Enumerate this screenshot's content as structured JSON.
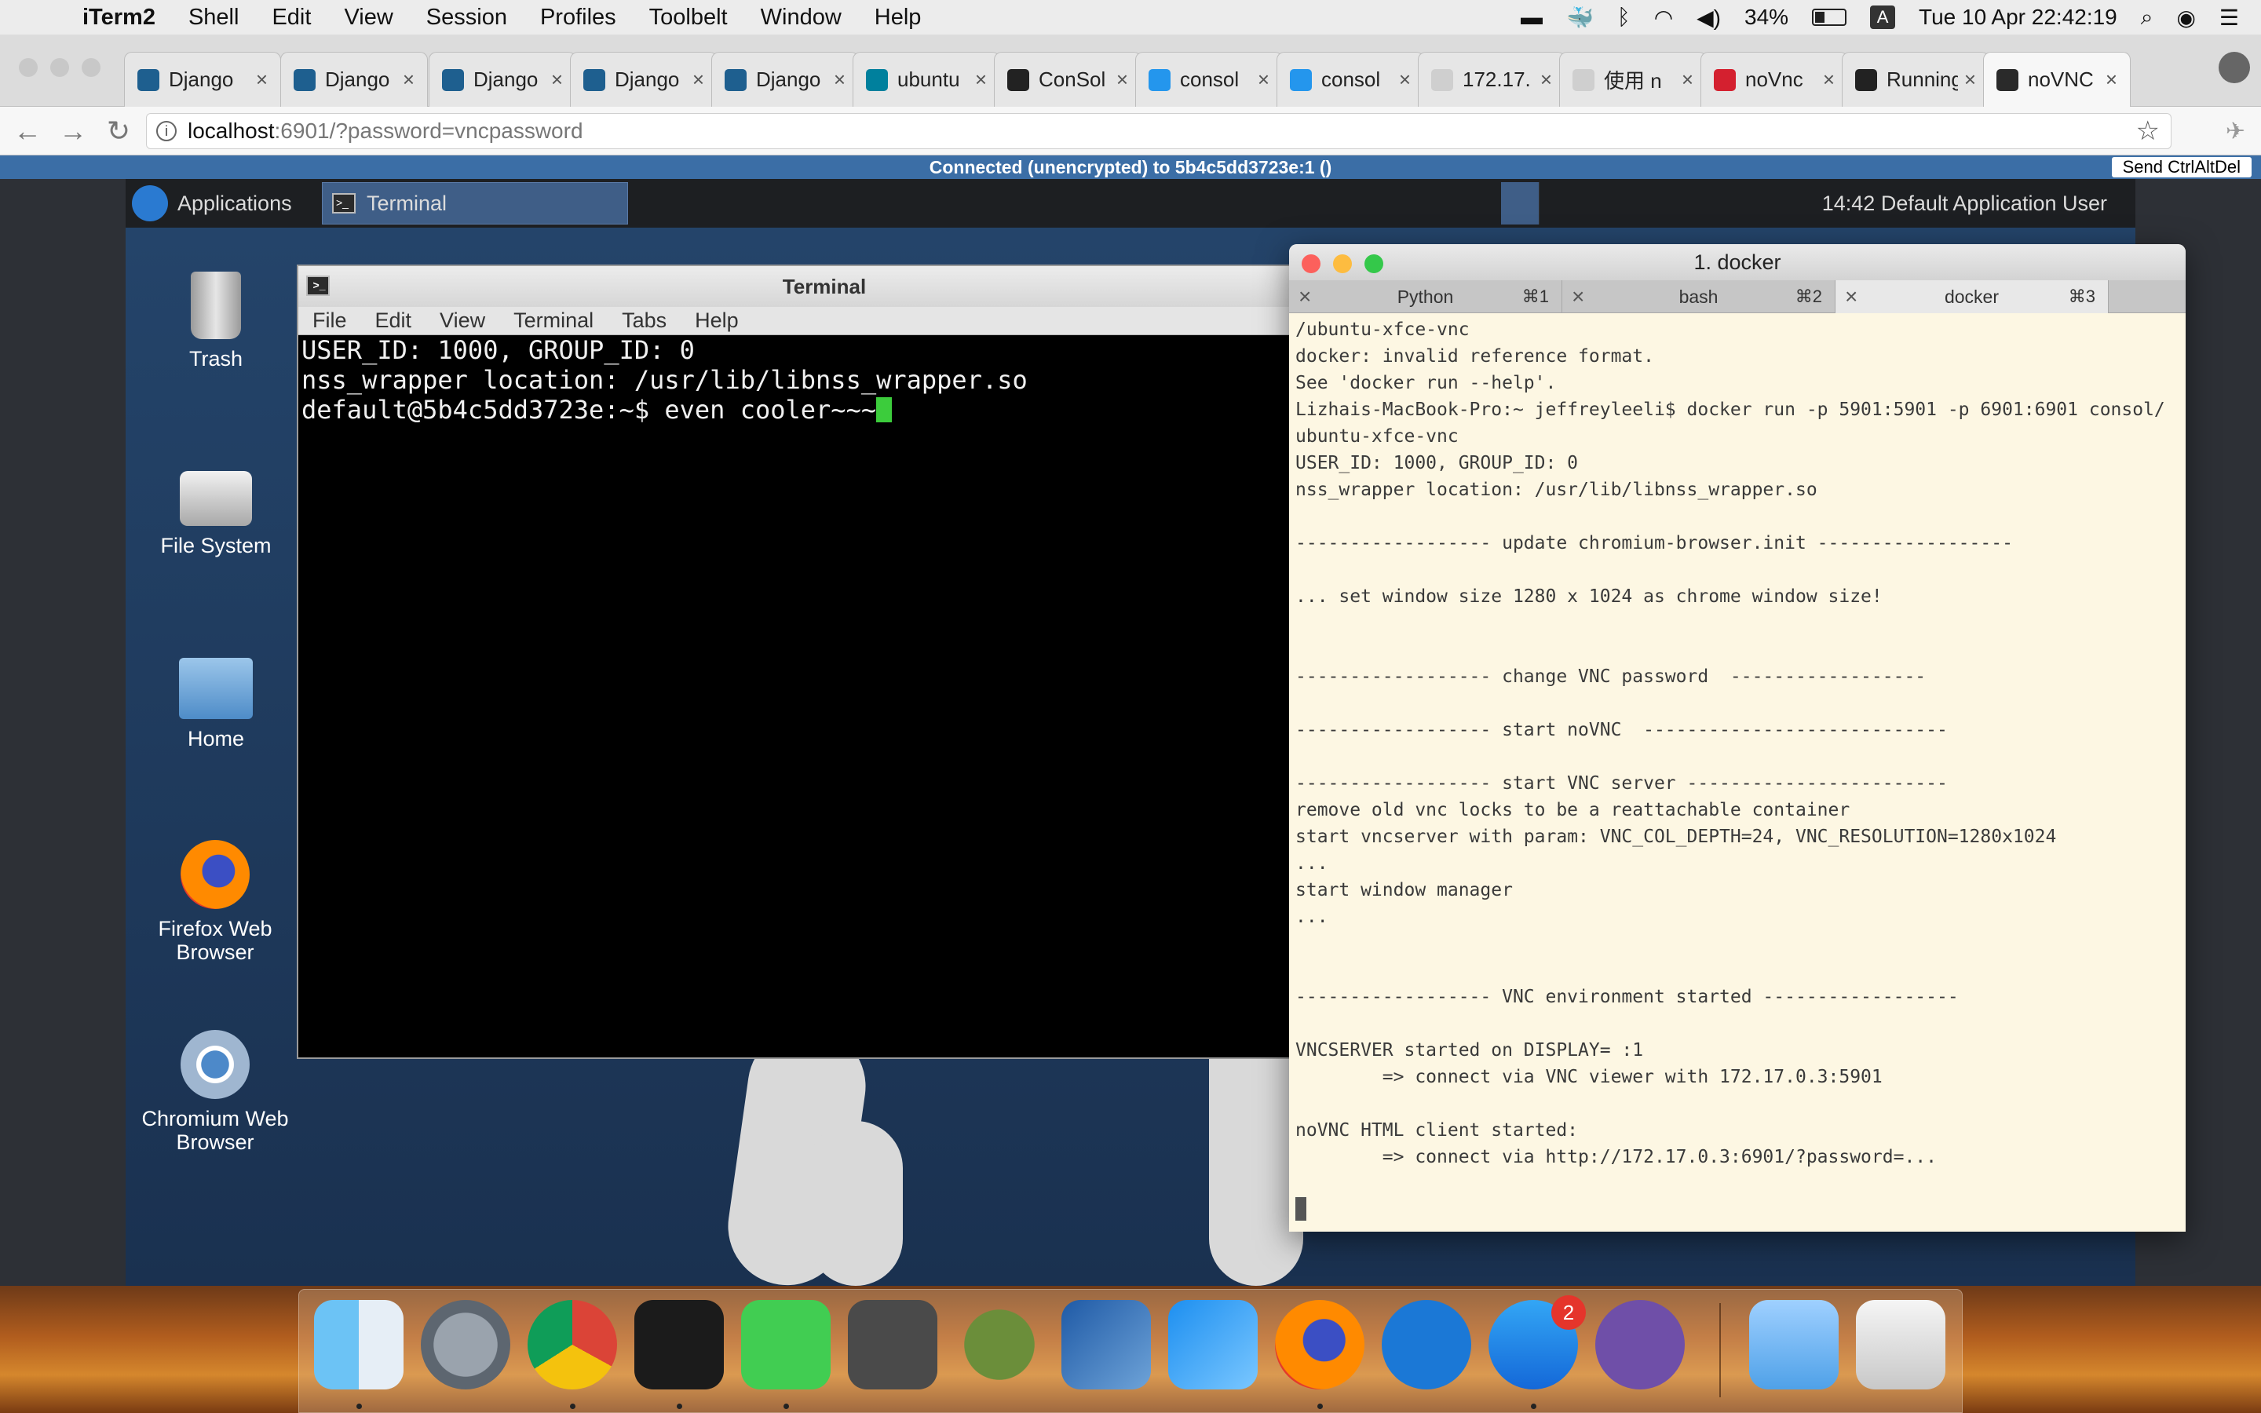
{
  "menubar": {
    "app": "iTerm2",
    "items": [
      "Shell",
      "Edit",
      "View",
      "Session",
      "Profiles",
      "Toolbelt",
      "Window",
      "Help"
    ],
    "battery": "34%",
    "input_source": "A",
    "datetime": "Tue 10 Apr  22:42:19"
  },
  "browser": {
    "tabs": [
      {
        "label": "Django",
        "favicon_color": "#1e5f8f"
      },
      {
        "label": "Django",
        "favicon_color": "#1e5f8f"
      },
      {
        "label": "Django",
        "favicon_color": "#1e5f8f"
      },
      {
        "label": "Django",
        "favicon_color": "#1e5f8f"
      },
      {
        "label": "Django",
        "favicon_color": "#1e5f8f"
      },
      {
        "label": "ubuntu",
        "favicon_color": "#00809d"
      },
      {
        "label": "ConSol",
        "favicon_color": "#222222"
      },
      {
        "label": "consol",
        "favicon_color": "#2496ed"
      },
      {
        "label": "consol",
        "favicon_color": "#2496ed"
      },
      {
        "label": "172.17.",
        "favicon_color": "#cfcfcf"
      },
      {
        "label": "使用 n",
        "favicon_color": "#cfcfcf"
      },
      {
        "label": "noVnc",
        "favicon_color": "#d4202f"
      },
      {
        "label": "Running",
        "favicon_color": "#222222"
      },
      {
        "label": "noVNC",
        "favicon_color": "#2a2a2a",
        "active": true
      }
    ],
    "url_host": "localhost",
    "url_rest": ":6901/?password=vncpassword"
  },
  "novnc": {
    "status": "Connected (unencrypted) to 5b4c5dd3723e:1 ()",
    "send_ctrl_alt_del": "Send CtrlAltDel"
  },
  "xfce": {
    "applications_label": "Applications",
    "task_label": "Terminal",
    "clock": "14:42",
    "user": "Default Application User",
    "desktop_icons": [
      "Trash",
      "File System",
      "Home",
      "Firefox Web Browser",
      "Chromium Web Browser"
    ],
    "terminal": {
      "title": "Terminal",
      "menus": [
        "File",
        "Edit",
        "View",
        "Terminal",
        "Tabs",
        "Help"
      ],
      "lines": [
        "USER_ID: 1000, GROUP_ID: 0",
        "nss_wrapper location: /usr/lib/libnss_wrapper.so",
        "default@5b4c5dd3723e:~$ even cooler~~~"
      ]
    }
  },
  "iterm": {
    "title": "1. docker",
    "tabs": [
      {
        "label": "Python",
        "shortcut": "⌘1"
      },
      {
        "label": "bash",
        "shortcut": "⌘2"
      },
      {
        "label": "docker",
        "shortcut": "⌘3",
        "active": true
      }
    ],
    "lines": [
      "/ubuntu-xfce-vnc",
      "docker: invalid reference format.",
      "See 'docker run --help'.",
      "Lizhais-MacBook-Pro:~ jeffreyleeli$ docker run -p 5901:5901 -p 6901:6901 consol/",
      "ubuntu-xfce-vnc",
      "USER_ID: 1000, GROUP_ID: 0",
      "nss_wrapper location: /usr/lib/libnss_wrapper.so",
      "",
      "------------------ update chromium-browser.init ------------------",
      "",
      "... set window size 1280 x 1024 as chrome window size!",
      "",
      "",
      "------------------ change VNC password  ------------------",
      "",
      "------------------ start noVNC  ----------------------------",
      "",
      "------------------ start VNC server ------------------------",
      "remove old vnc locks to be a reattachable container",
      "start vncserver with param: VNC_COL_DEPTH=24, VNC_RESOLUTION=1280x1024",
      "...",
      "start window manager",
      "...",
      "",
      "",
      "------------------ VNC environment started ------------------",
      "",
      "VNCSERVER started on DISPLAY= :1",
      "        => connect via VNC viewer with 172.17.0.3:5901",
      "",
      "noVNC HTML client started:",
      "        => connect via http://172.17.0.3:6901/?password=...",
      ""
    ]
  },
  "dock": {
    "apps": [
      "finder-icon",
      "launchpad-icon",
      "chrome-icon",
      "terminal-icon",
      "qt-creator-icon",
      "sublime-text-icon",
      "turtle-icon",
      "virtualbox-icon",
      "xcode-icon",
      "firefox-icon",
      "1password-icon",
      "app-store-icon",
      "github-desktop-icon",
      "downloads-folder-icon",
      "trash-icon"
    ],
    "app_store_badge": "2"
  }
}
